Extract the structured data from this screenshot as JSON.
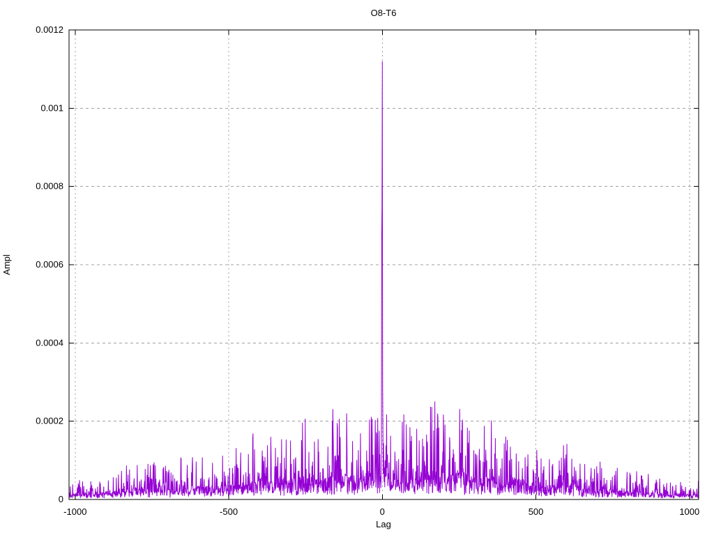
{
  "chart_data": {
    "type": "line",
    "title": "O8-T6",
    "xlabel": "Lag",
    "ylabel": "Ampl",
    "xlim": [
      -1020,
      1030
    ],
    "ylim": [
      0,
      0.0012
    ],
    "x_ticks": [
      -1000,
      -500,
      0,
      500,
      1000
    ],
    "x_tick_labels": [
      "-1000",
      "-500",
      "0",
      "500",
      "1000"
    ],
    "y_ticks": [
      0,
      0.0002,
      0.0004,
      0.0006,
      0.0008,
      0.001,
      0.0012
    ],
    "y_tick_labels": [
      "0",
      "0.0002",
      "0.0004",
      "0.0006",
      "0.0008",
      "0.001",
      "0.0012"
    ],
    "grid": true,
    "legend_position": "none",
    "line_color": "#9400d3",
    "grid_color": "#a0a0a0",
    "border_color": "#000000",
    "background_color": "#ffffff",
    "main_peak": {
      "lag": 0,
      "ampl": 0.00112
    },
    "shoulder_peaks": [
      [
        -2,
        0.00066
      ],
      [
        -1,
        0.00075
      ],
      [
        1,
        0.0003
      ]
    ],
    "noise_envelope": [
      [
        -1020,
        5e-05
      ],
      [
        -950,
        5e-05
      ],
      [
        -900,
        6e-05
      ],
      [
        -850,
        8e-05
      ],
      [
        -800,
        0.00012
      ],
      [
        -750,
        0.0001
      ],
      [
        -700,
        9e-05
      ],
      [
        -650,
        0.00011
      ],
      [
        -600,
        0.00013
      ],
      [
        -550,
        0.00012
      ],
      [
        -500,
        0.00014
      ],
      [
        -450,
        0.00014
      ],
      [
        -400,
        0.00022
      ],
      [
        -350,
        0.00016
      ],
      [
        -300,
        0.00019
      ],
      [
        -250,
        0.00021
      ],
      [
        -200,
        0.00019
      ],
      [
        -150,
        0.00026
      ],
      [
        -100,
        0.00022
      ],
      [
        -50,
        0.00023
      ],
      [
        0,
        0.00026
      ],
      [
        50,
        0.00024
      ],
      [
        100,
        0.00021
      ],
      [
        150,
        0.00025
      ],
      [
        200,
        0.00026
      ],
      [
        250,
        0.00025
      ],
      [
        300,
        0.00019
      ],
      [
        350,
        0.00024
      ],
      [
        400,
        0.00016
      ],
      [
        450,
        0.00018
      ],
      [
        500,
        0.00015
      ],
      [
        550,
        0.00012
      ],
      [
        600,
        0.00016
      ],
      [
        650,
        0.00011
      ],
      [
        700,
        0.00012
      ],
      [
        750,
        9e-05
      ],
      [
        800,
        8e-05
      ],
      [
        850,
        7e-05
      ],
      [
        900,
        6e-05
      ],
      [
        950,
        5e-05
      ],
      [
        1030,
        5e-05
      ]
    ],
    "lag_step": 1,
    "noise_seed": 20240816
  }
}
